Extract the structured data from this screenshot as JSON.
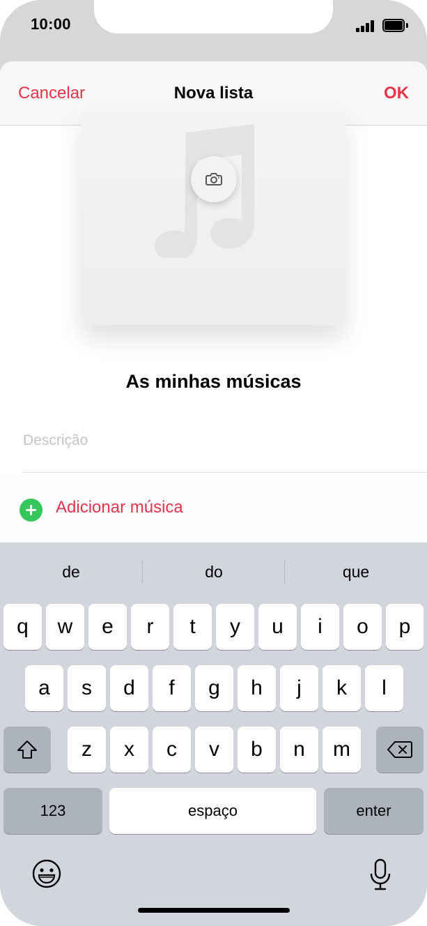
{
  "status_bar": {
    "time": "10:00",
    "signal_icon": "cellular-signal-icon",
    "battery_icon": "battery-icon"
  },
  "nav": {
    "cancel_label": "Cancelar",
    "title": "Nova lista",
    "ok_label": "OK"
  },
  "artwork": {
    "placeholder_icon": "music-note-icon",
    "camera_icon": "camera-icon"
  },
  "playlist": {
    "name": "As minhas músicas",
    "description_placeholder": "Descrição",
    "add_music_label": "Adicionar música",
    "add_icon": "plus-circle-icon"
  },
  "keyboard": {
    "suggestions": [
      "de",
      "do",
      "que"
    ],
    "row1": [
      "q",
      "w",
      "e",
      "r",
      "t",
      "y",
      "u",
      "i",
      "o",
      "p"
    ],
    "row2": [
      "a",
      "s",
      "d",
      "f",
      "g",
      "h",
      "j",
      "k",
      "l"
    ],
    "row3": [
      "z",
      "x",
      "c",
      "v",
      "b",
      "n",
      "m"
    ],
    "shift_icon": "shift-icon",
    "delete_icon": "backspace-icon",
    "numbers_label": "123",
    "space_label": "espaço",
    "enter_label": "enter",
    "emoji_icon": "emoji-icon",
    "mic_icon": "microphone-icon"
  },
  "colors": {
    "accent": "#e8334a",
    "add_green": "#35c759",
    "keyboard_bg": "#d2d5db",
    "dark_key": "#adb3bd"
  }
}
